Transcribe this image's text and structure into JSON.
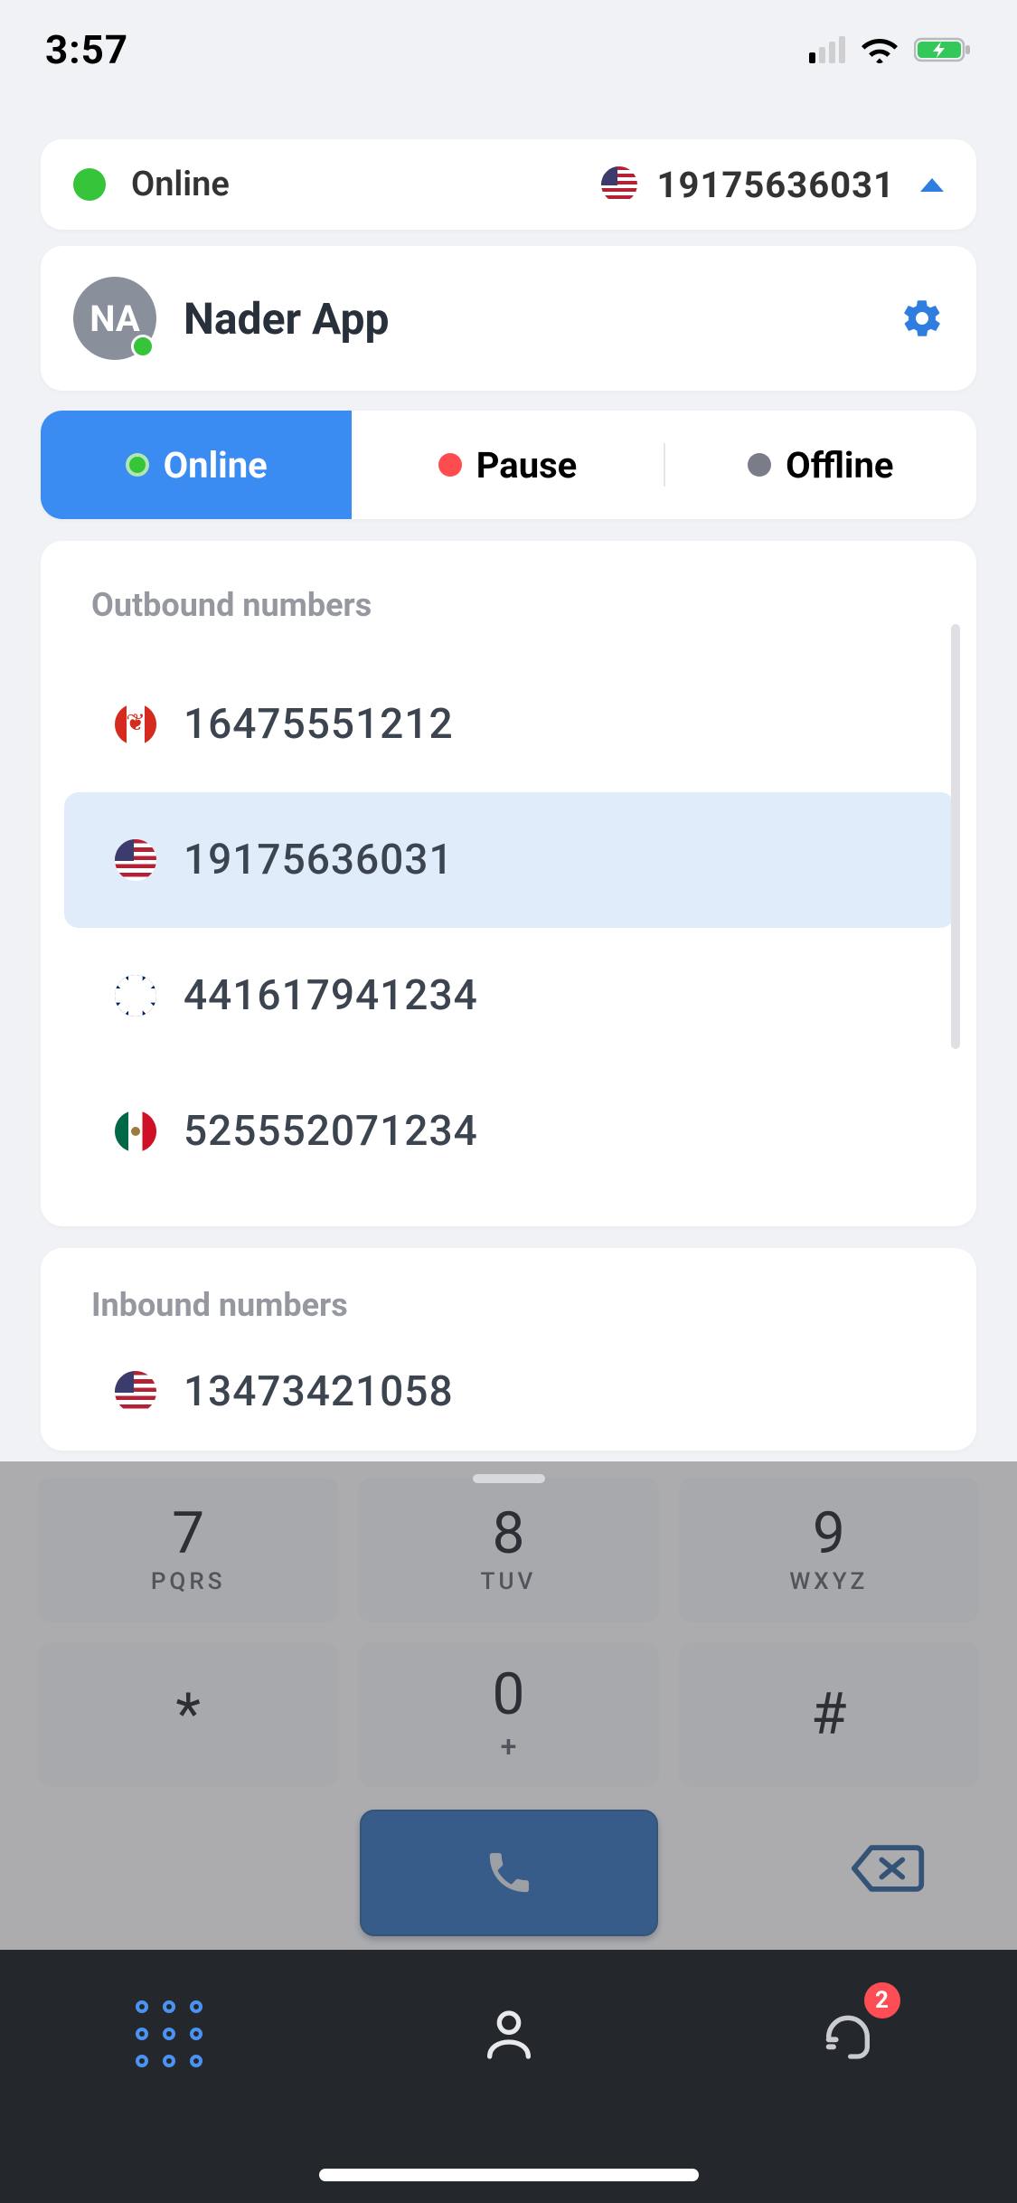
{
  "status_bar": {
    "time": "3:57"
  },
  "top": {
    "status_label": "Online",
    "number": "19175636031"
  },
  "profile": {
    "initials": "NA",
    "name": "Nader App"
  },
  "segmented": {
    "online": "Online",
    "pause": "Pause",
    "offline": "Offline"
  },
  "outbound": {
    "title": "Outbound numbers",
    "items": [
      {
        "flag": "ca",
        "number": "16475551212",
        "selected": false
      },
      {
        "flag": "us",
        "number": "19175636031",
        "selected": true
      },
      {
        "flag": "uk",
        "number": "441617941234",
        "selected": false
      },
      {
        "flag": "mx",
        "number": "525552071234",
        "selected": false
      }
    ]
  },
  "inbound": {
    "title": "Inbound numbers",
    "items": [
      {
        "flag": "us",
        "number": "13473421058"
      }
    ]
  },
  "keypad": {
    "keys": [
      {
        "digit": "7",
        "letters": "PQRS"
      },
      {
        "digit": "8",
        "letters": "TUV"
      },
      {
        "digit": "9",
        "letters": "WXYZ"
      },
      {
        "digit": "*",
        "letters": ""
      },
      {
        "digit": "0",
        "letters": "+"
      },
      {
        "digit": "#",
        "letters": ""
      }
    ]
  },
  "nav": {
    "badge_count": "2"
  }
}
